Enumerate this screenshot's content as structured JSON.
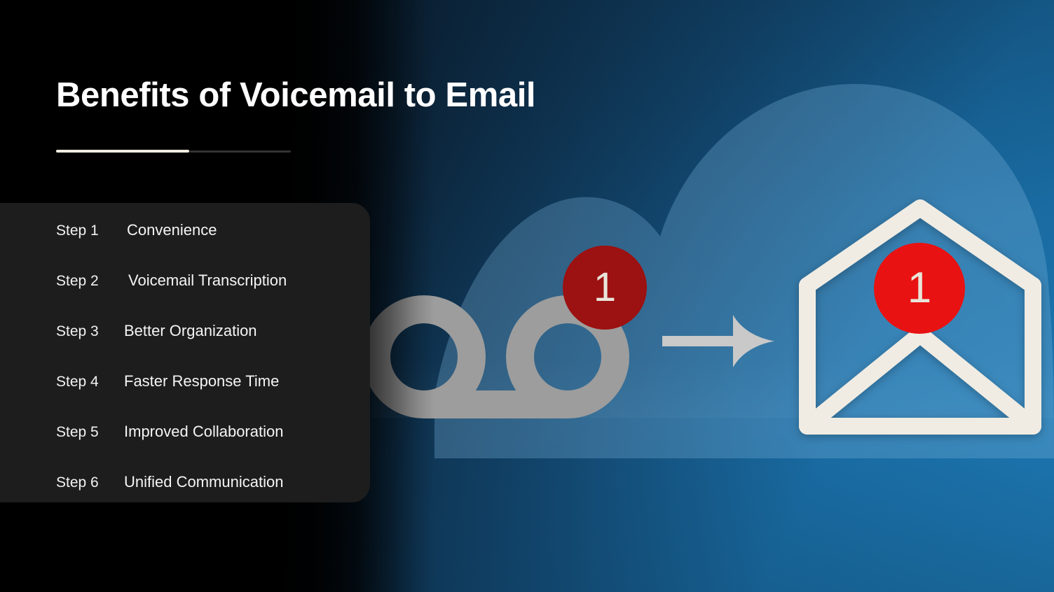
{
  "page": {
    "title": "Benefits of Voicemail to Email"
  },
  "divider": {
    "fill_color": "#efece0",
    "track_color": "#333333"
  },
  "steps": {
    "items": [
      {
        "number": "Step 1",
        "label": "Convenience"
      },
      {
        "number": "Step 2",
        "label": "Voicemail Transcription"
      },
      {
        "number": "Step 3",
        "label": "Better Organization"
      },
      {
        "number": "Step 4",
        "label": "Faster Response Time"
      },
      {
        "number": "Step 5",
        "label": "Improved Collaboration"
      },
      {
        "number": "Step 6",
        "label": "Unified Communication"
      }
    ]
  },
  "illustration": {
    "voicemail_icon": "voicemail-tape-icon",
    "voicemail_badge_count": "1",
    "arrow_icon": "arrow-right-icon",
    "envelope_icon": "open-envelope-icon",
    "envelope_badge_count": "1",
    "cloud_icon": "cloud-shape",
    "colors": {
      "envelope_stroke": "#f0ece3",
      "envelope_badge": "#e81212",
      "voicemail_badge": "#9c1111",
      "voicemail_stroke": "#9b9b9b",
      "arrow": "#c9c9c9",
      "background_dark": "#04080c",
      "background_blue": "#1d79b4",
      "card_background": "#1d1d1d",
      "title_color": "#ffffff"
    }
  }
}
